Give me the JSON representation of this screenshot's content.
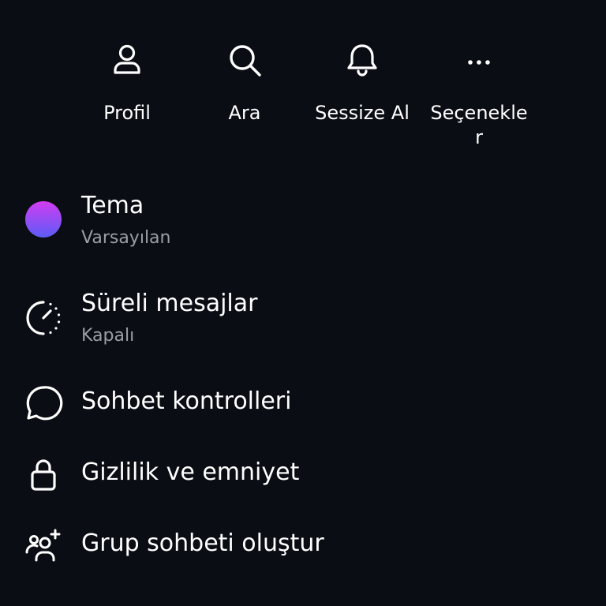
{
  "actions": {
    "profile": {
      "label": "Profil",
      "icon": "person-icon"
    },
    "search": {
      "label": "Ara",
      "icon": "search-icon"
    },
    "mute": {
      "label": "Sessize Al",
      "icon": "bell-icon"
    },
    "options": {
      "label": "Seçenekler",
      "icon": "more-horizontal-icon"
    }
  },
  "rows": {
    "theme": {
      "title": "Tema",
      "subtitle": "Varsayılan",
      "icon": "theme-color-dot"
    },
    "disappearing": {
      "title": "Süreli mesajlar",
      "subtitle": "Kapalı",
      "icon": "timer-icon"
    },
    "chat_controls": {
      "title": "Sohbet kontrolleri",
      "icon": "chat-bubble-icon"
    },
    "privacy": {
      "title": "Gizlilik ve emniyet",
      "icon": "lock-icon"
    },
    "create_group": {
      "title": "Grup sohbeti oluştur",
      "icon": "add-people-icon"
    }
  },
  "colors": {
    "background": "#0b0d14",
    "text_primary": "#ffffff",
    "text_secondary": "#9b9ea6",
    "theme_gradient_start": "#d13df2",
    "theme_gradient_end": "#5b5cf6"
  }
}
